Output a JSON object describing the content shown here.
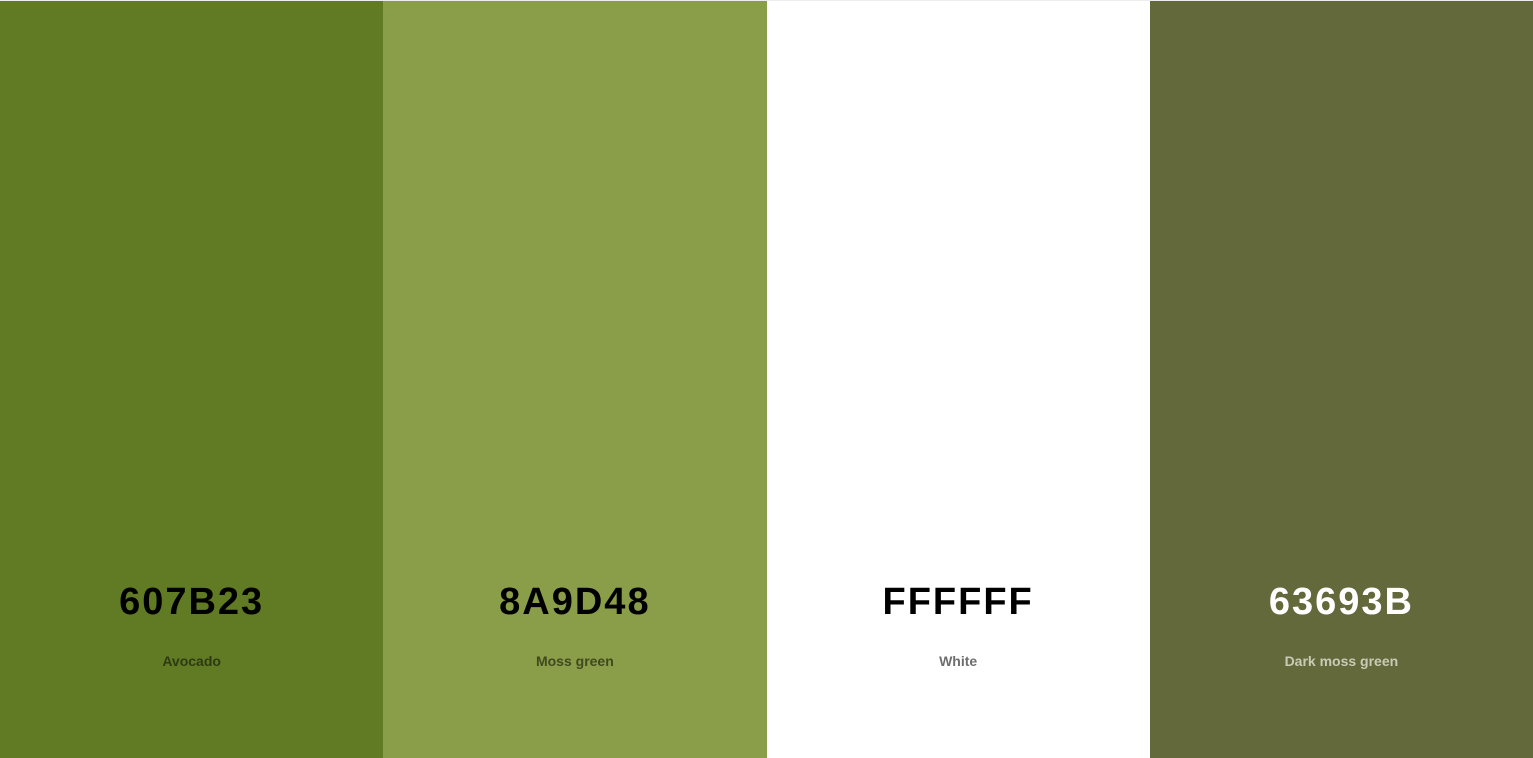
{
  "palette": {
    "swatches": [
      {
        "hex_label": "607B23",
        "name": "Avocado",
        "color": "#607B23",
        "hex_color": "#000000",
        "name_color": "#2E3A12"
      },
      {
        "hex_label": "8A9D48",
        "name": "Moss green",
        "color": "#8A9D48",
        "hex_color": "#000000",
        "name_color": "#3F4A1E"
      },
      {
        "hex_label": "FFFFFF",
        "name": "White",
        "color": "#FFFFFF",
        "hex_color": "#000000",
        "name_color": "#6E6E6E"
      },
      {
        "hex_label": "63693B",
        "name": "Dark moss green",
        "color": "#63693B",
        "hex_color": "#FFFFFF",
        "name_color": "#C9CCB5"
      }
    ]
  }
}
